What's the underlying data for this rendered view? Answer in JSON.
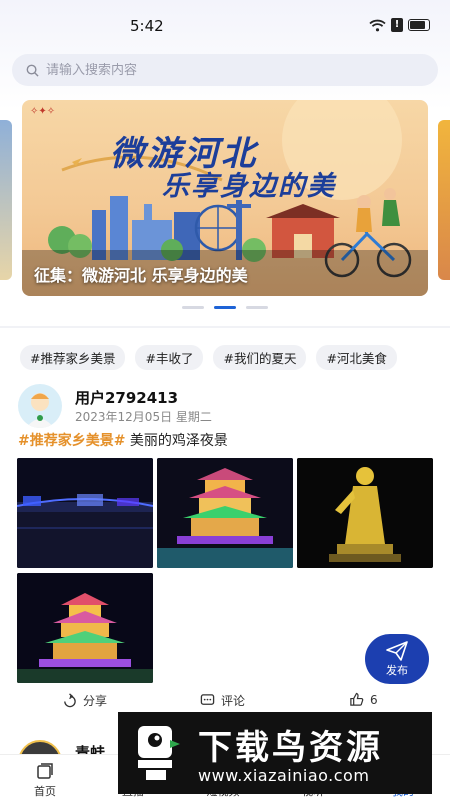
{
  "status_bar": {
    "time": "5:42"
  },
  "search": {
    "placeholder": "请输入搜索内容"
  },
  "banner": {
    "headline_1": "微游河北",
    "headline_2": "乐享身边的美",
    "caption": "征集：微游河北 乐享身边的美",
    "dots": 3,
    "active_dot": 1
  },
  "tags": [
    "#推荐家乡美景",
    "#丰收了",
    "#我们的夏天",
    "#河北美食"
  ],
  "post": {
    "user": "用户2792413",
    "date": "2023年12月05日 星期二",
    "hashtag": "#推荐家乡美景#",
    "text": " 美丽的鸡泽夜景",
    "photos": [
      "night-riverside",
      "lit-pavilion",
      "golden-statue",
      "lit-pagoda"
    ],
    "actions": {
      "share": "分享",
      "comment": "评论",
      "like_count": "6"
    }
  },
  "post2": {
    "user": "青蛙"
  },
  "fab": {
    "label": "发布"
  },
  "bottom_nav": [
    {
      "label": "首页",
      "icon": "home-icon",
      "active": false
    },
    {
      "label": "直播",
      "icon": "live-icon",
      "active": false
    },
    {
      "label": "短视频",
      "icon": "video-icon",
      "active": false
    },
    {
      "label": "视听",
      "icon": "audio-icon",
      "active": false
    },
    {
      "label": "我的",
      "icon": "profile-icon",
      "active": true
    }
  ],
  "watermark": {
    "title": "下载鸟资源",
    "url": "www.xiazainiao.com"
  },
  "colors": {
    "accent": "#1e63d6",
    "hashtag": "#e5912b",
    "fab": "#1c3fb0"
  }
}
